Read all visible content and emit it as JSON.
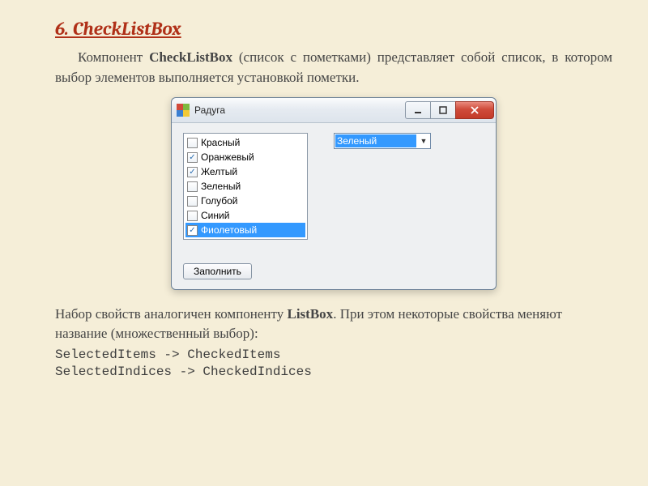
{
  "heading": "6. CheckListBox",
  "para1_pre": "Компонент ",
  "para1_bold": "CheckListBox",
  "para1_post": " (список с пометками) представляет собой список, в котором выбор элементов выполняется установкой пометки.",
  "window": {
    "title": "Радуга",
    "checklist": [
      {
        "label": "Красный",
        "checked": false,
        "selected": false
      },
      {
        "label": "Оранжевый",
        "checked": true,
        "selected": false
      },
      {
        "label": "Желтый",
        "checked": true,
        "selected": false
      },
      {
        "label": "Зеленый",
        "checked": false,
        "selected": false
      },
      {
        "label": "Голубой",
        "checked": false,
        "selected": false
      },
      {
        "label": "Синий",
        "checked": false,
        "selected": false
      },
      {
        "label": "Фиолетовый",
        "checked": true,
        "selected": true
      }
    ],
    "combo_value": "Зеленый",
    "fill_button": "Заполнить"
  },
  "para2_pre": "Набор свойств аналогичен компоненту ",
  "para2_bold": "ListBox",
  "para2_post": ". При этом некоторые свойства меняют название (множественный выбор):",
  "code_line1": "SelectedItems -> CheckedItems",
  "code_line2": "SelectedIndices -> CheckedIndices"
}
